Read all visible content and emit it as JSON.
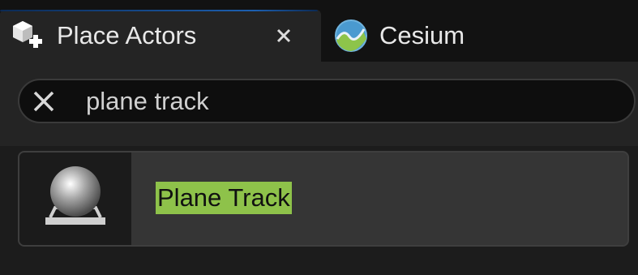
{
  "tabs": [
    {
      "label": "Place Actors",
      "icon": "place-actors-icon",
      "active": true,
      "close_glyph": "✕"
    },
    {
      "label": "Cesium",
      "icon": "cesium-icon",
      "active": false
    }
  ],
  "search": {
    "value": "plane track",
    "clear_icon": "clear-x-icon"
  },
  "results": [
    {
      "label": "Plane Track",
      "icon": "sphere-actor-icon",
      "highlight_color": "#8ec24a"
    }
  ],
  "colors": {
    "accent_blue": "#1c5fb0",
    "highlight_green": "#8ec24a",
    "panel_bg": "#242424"
  }
}
